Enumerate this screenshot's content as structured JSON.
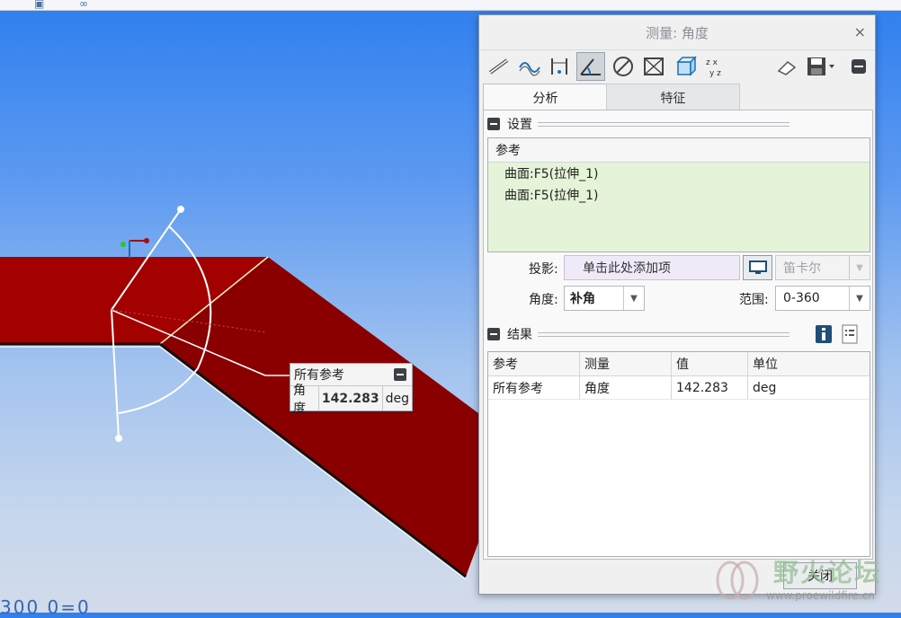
{
  "dialog": {
    "title": "测量: 角度",
    "close_glyph": "×",
    "tabs": [
      "分析",
      "特征"
    ],
    "settings": {
      "title": "设置",
      "ref_header": "参考",
      "ref_items": [
        "曲面:F5(拉伸_1)",
        "曲面:F5(拉伸_1)"
      ],
      "projection_label": "投影:",
      "projection_placeholder": "单击此处添加项",
      "coord_sys": "笛卡尔",
      "angle_label": "角度:",
      "angle_value": "补角",
      "range_label": "范围:",
      "range_value": "0-360"
    },
    "results": {
      "title": "结果",
      "headers": [
        "参考",
        "测量",
        "值",
        "单位"
      ],
      "rows": [
        [
          "所有参考",
          "角度",
          "142.283",
          "deg"
        ]
      ]
    },
    "close_button": "关闭"
  },
  "callout": {
    "title": "所有参考",
    "label": "角度",
    "value": "142.283",
    "unit": "deg"
  },
  "watermark": {
    "text": "野火论坛",
    "url": "www.proewildfire.cn"
  },
  "viewport_text": "300  0=0",
  "colors": {
    "model": "#8b0000",
    "accent": "#1f4e79"
  },
  "icons": [
    "distance-icon",
    "length-icon",
    "diameter-icon",
    "angle-icon",
    "radius-icon",
    "area-icon",
    "volume-icon",
    "transform-icon",
    "eraser-icon",
    "save-icon"
  ]
}
